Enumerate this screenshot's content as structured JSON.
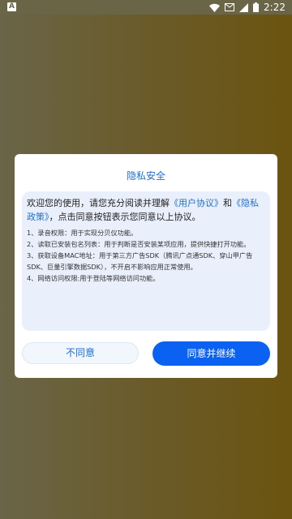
{
  "status_bar": {
    "left_badge": "A",
    "time": "2:22",
    "icons": [
      "wifi-icon",
      "mail-icon",
      "signal-icon",
      "battery-icon"
    ]
  },
  "dialog": {
    "title": "隐私安全",
    "intro_prefix": "欢迎您的使用，请您充分阅读并理解",
    "link_user_agreement": "《用户协议》",
    "and": "和",
    "link_privacy_policy": "《隐私政策》",
    "intro_suffix": "，点击同意按钮表示您同意以上协议。",
    "permissions": [
      "1、录音权限：用于实现分贝仪功能。",
      "2、读取已安装包名列表：用于判断是否安装某项应用，提供快捷打开功能。",
      "3、获取设备MAC地址：用于第三方广告SDK（腾讯广点通SDK、穿山甲广告SDK、巨量引擎数据SDK），不开启不影响应用正常使用。",
      "4、网络访问权限:用于登陆等网络访问功能。"
    ],
    "disagree_label": "不同意",
    "agree_label": "同意并继续"
  },
  "colors": {
    "accent": "#1f6fd0",
    "primary_button": "#0b62f2",
    "content_bg": "#eaf0fb",
    "overlay": "#6a5a26"
  }
}
